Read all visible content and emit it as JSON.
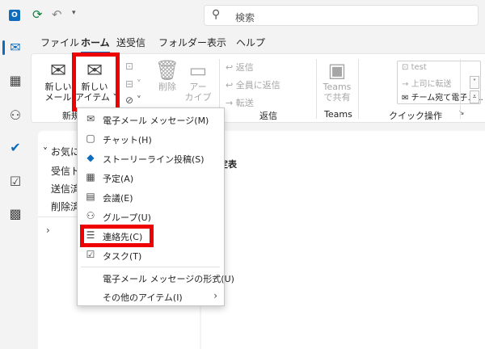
{
  "titlebar": {
    "search_placeholder": "検索"
  },
  "tabs": [
    {
      "label": "ファイル"
    },
    {
      "label": "ホーム"
    },
    {
      "label": "送受信"
    },
    {
      "label": "フォルダー"
    },
    {
      "label": "表示"
    },
    {
      "label": "ヘルプ"
    }
  ],
  "ribbon": {
    "new_mail_line1": "新しい",
    "new_mail_line2": "メール",
    "new_items_line1": "新しい",
    "new_items_line2": "アイテム",
    "new_group_label": "新規",
    "delete_label": "削除",
    "archive_line1": "アー",
    "archive_line2": "カイブ",
    "reply": "返信",
    "reply_all": "全員に返信",
    "forward": "転送",
    "respond_group_label": "返信",
    "teams_line1": "Teams",
    "teams_line2": "で共有",
    "teams_group_label": "Teams",
    "quicksteps": [
      "test",
      "上司に転送",
      "チーム宛て電子メ..."
    ],
    "quicksteps_group_label": "クイック操作"
  },
  "folderpane": {
    "favorites_header": "お気に",
    "items": [
      "受信ト",
      "送信済",
      "削除済"
    ]
  },
  "msglist": {
    "heading": "定表"
  },
  "dropdown": {
    "items": [
      {
        "label": "電子メール メッセージ(M)",
        "icon": "mail-icon"
      },
      {
        "label": "チャット(H)",
        "icon": "chat-icon"
      },
      {
        "label": "ストーリーライン投稿(S)",
        "icon": "storyline-icon"
      },
      {
        "label": "予定(A)",
        "icon": "calendar-icon"
      },
      {
        "label": "会議(E)",
        "icon": "meeting-icon"
      },
      {
        "label": "グループ(U)",
        "icon": "group-icon"
      },
      {
        "label": "連絡先(C)",
        "icon": "contact-icon"
      },
      {
        "label": "タスク(T)",
        "icon": "task-icon"
      },
      {
        "label": "電子メール メッセージの形式(U)",
        "icon": ""
      },
      {
        "label": "その他のアイテム(I)",
        "icon": ""
      }
    ]
  },
  "colors": {
    "accent": "#0f6cbd",
    "highlight": "#ee0000"
  }
}
